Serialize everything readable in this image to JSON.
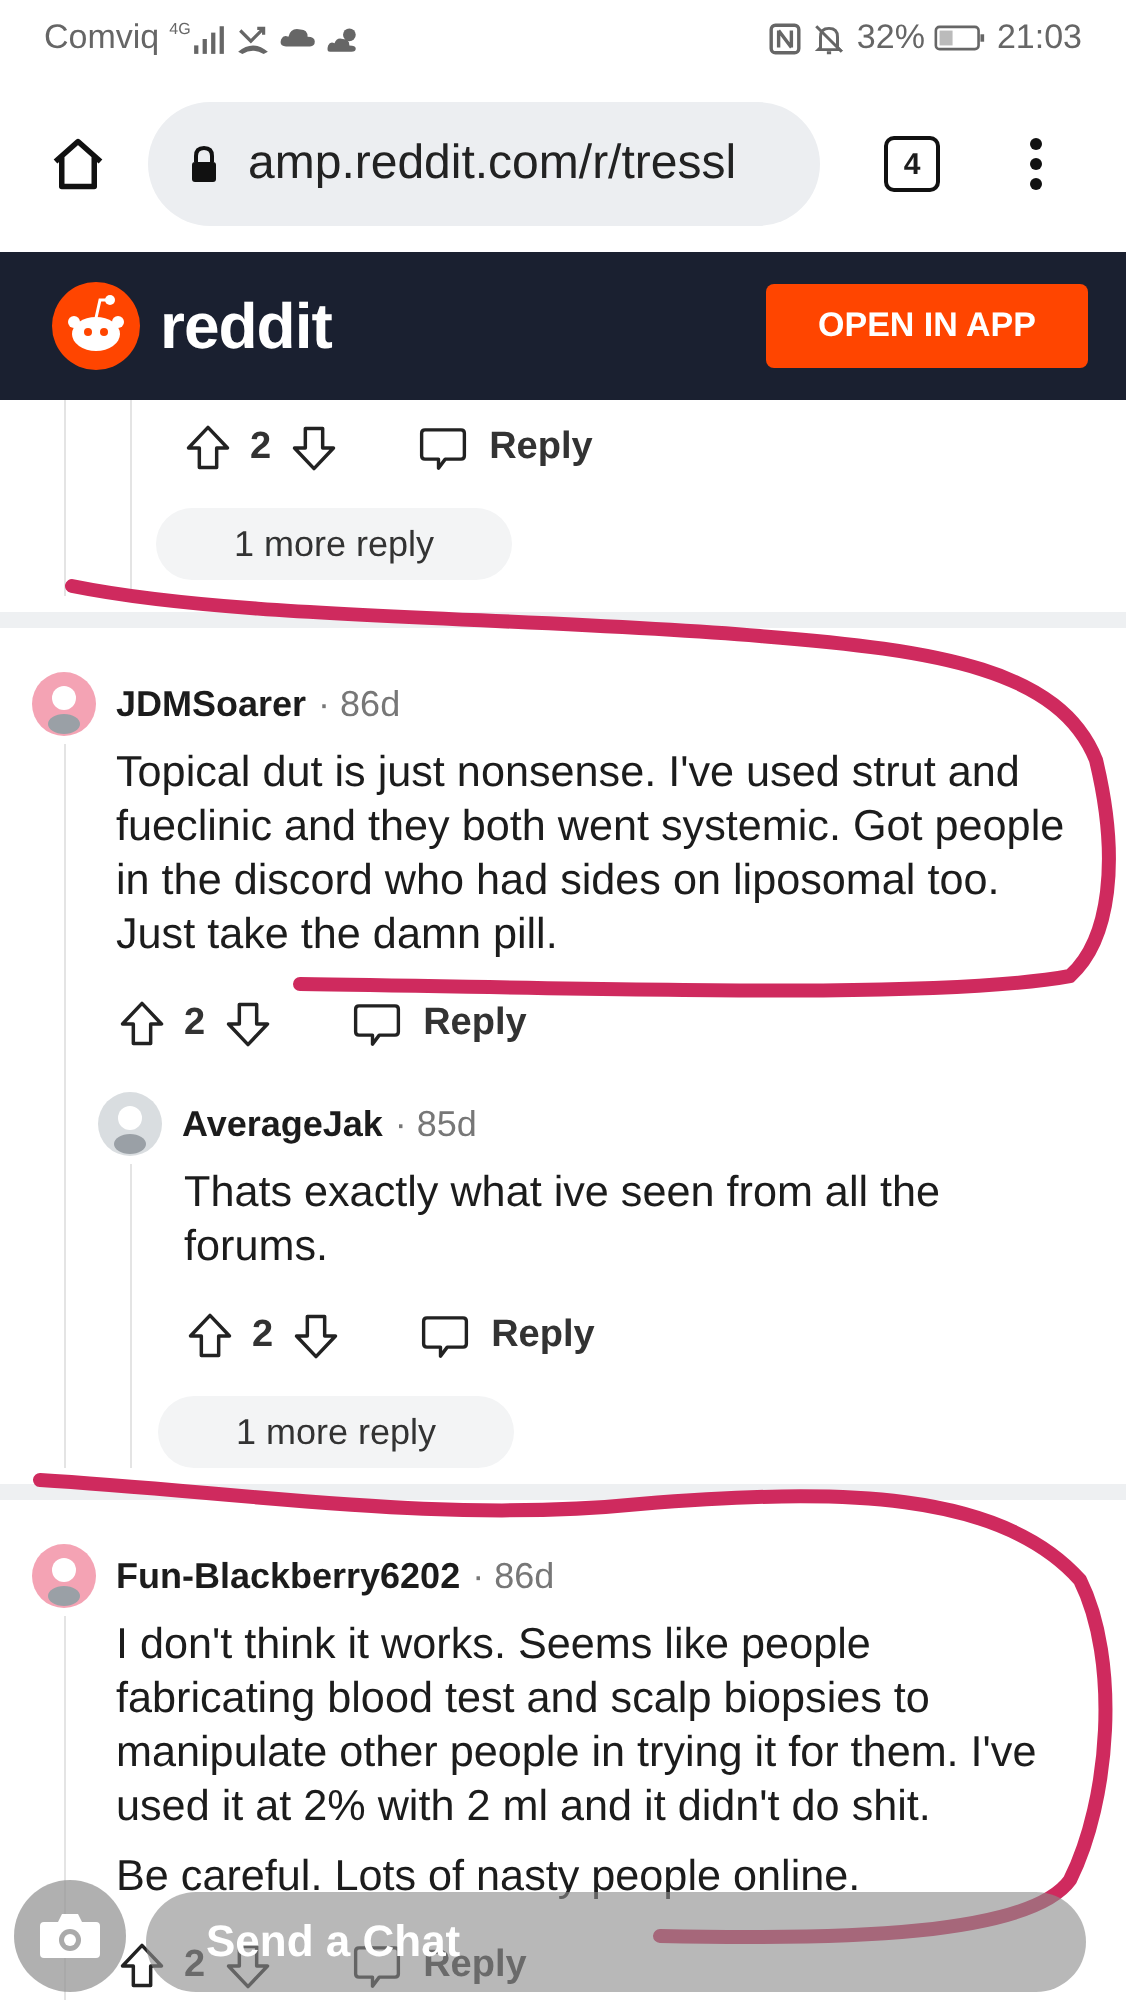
{
  "status_bar": {
    "carrier": "Comviq",
    "network": "4G",
    "battery": "32%",
    "time": "21:03"
  },
  "browser": {
    "url": "amp.reddit.com/r/tressl",
    "tab_count": "4"
  },
  "header": {
    "logo_text": "reddit",
    "open_button": "OPEN IN APP"
  },
  "thread_tail": {
    "votes": "2",
    "reply": "Reply",
    "more_replies": "1 more reply"
  },
  "comments": [
    {
      "author": "JDMSoarer",
      "age": "· 86d",
      "color": "#f4a3b4",
      "paragraphs": [
        "Topical dut is just nonsense. I've used strut and fueclinic and they both went systemic. Got people in the discord who had sides on liposomal too. Just take the damn pill."
      ],
      "votes": "2",
      "reply": "Reply",
      "children": [
        {
          "author": "AverageJak",
          "age": "· 85d",
          "color": "#d9dde0",
          "paragraphs": [
            "Thats exactly what ive seen from all the forums."
          ],
          "votes": "2",
          "reply": "Reply",
          "more_replies": "1 more reply"
        }
      ]
    },
    {
      "author": "Fun-Blackberry6202",
      "age": "· 86d",
      "color": "#f4a3b4",
      "paragraphs": [
        "I don't think it works. Seems like people fabricating blood test and scalp biopsies to manipulate other people in trying it for them. I've used it at 2% with 2 ml and it didn't do shit.",
        "Be careful. Lots of nasty people online."
      ],
      "votes": "2",
      "reply": "Reply"
    }
  ],
  "chat_bar": {
    "placeholder": "Send a Chat"
  }
}
